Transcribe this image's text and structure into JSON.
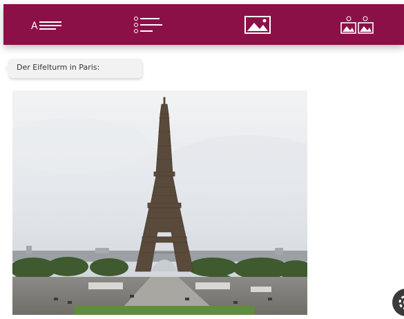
{
  "toolbar": {
    "tabs": [
      {
        "icon": "text-format-icon",
        "glyph": "A"
      },
      {
        "icon": "numbered-list-icon"
      },
      {
        "icon": "image-icon"
      },
      {
        "icon": "image-pair-icon"
      }
    ],
    "accent": "#8c1048"
  },
  "message": {
    "text": "Der Eifelturm in Paris:"
  },
  "photo": {
    "icon": "eiffel-tower-photo",
    "sky_color": "#dfe3e8",
    "tower_color": "#5a4a3c"
  },
  "settings": {
    "icon": "gear-icon"
  }
}
